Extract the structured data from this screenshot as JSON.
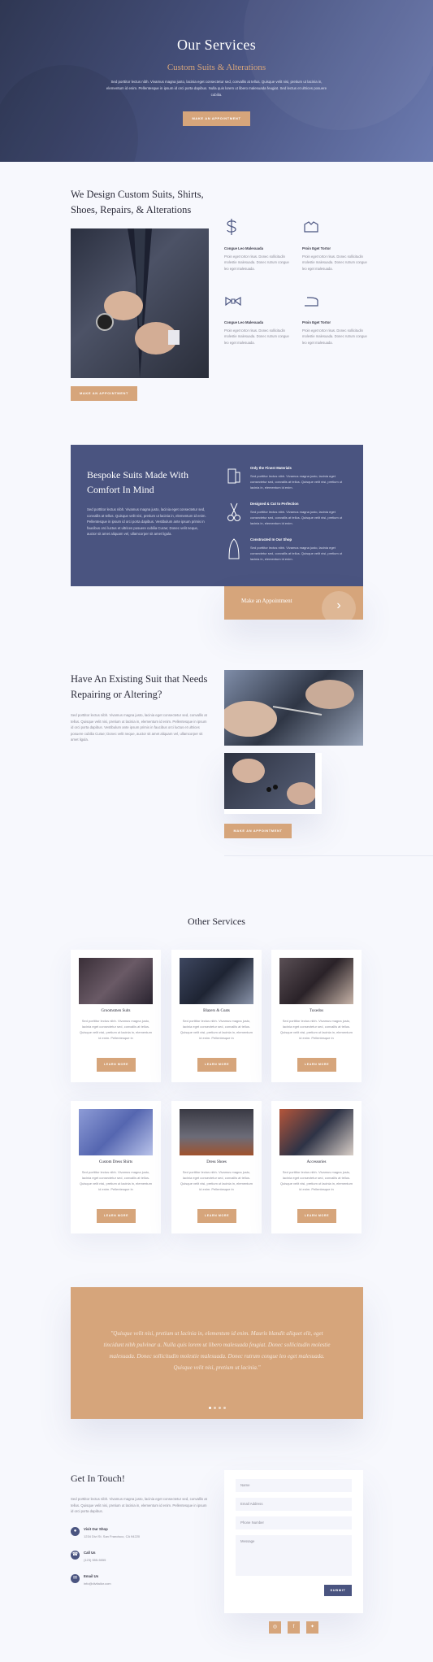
{
  "hero": {
    "title": "Our Services",
    "subtitle": "Custom Suits & Alterations",
    "body": "Sed porttitor lectus nibh. Vivamus magna justo, lacinia eget consectetur sed, convallis at tellus. Quisque velit nisi, pretium ut lacinia in, elementum id enim. Pellentesque in ipsum id orci porta dapibus. Nulla quis lorem ut libero malesuada feugiat. Sed lectus et ultrices posuere cubilia.",
    "button": "Make an Appointment"
  },
  "design": {
    "title": "We Design Custom Suits, Shirts, Shoes, Repairs, & Alterations",
    "button": "Make an Appointment",
    "features": [
      {
        "icon": "dollar-needle-icon",
        "title": "Congue Leo Malesuada",
        "text": "Proin eget tortor risus. Donec sollicitudin molestie malesuada. Donec rutrum congue leo eget malesuada."
      },
      {
        "icon": "shirt-icon",
        "title": "Proin Eget Tortor",
        "text": "Proin eget tortor risus. Donec sollicitudin molestie malesuada. Donec rutrum congue leo eget malesuada."
      },
      {
        "icon": "bowtie-icon",
        "title": "Congue Leo Malesuada",
        "text": "Proin eget tortor risus. Donec sollicitudin molestie malesuada. Donec rutrum congue leo eget malesuada."
      },
      {
        "icon": "iron-icon",
        "title": "Proin Eget Tortor",
        "text": "Proin eget tortor risus. Donec sollicitudin molestie malesuada. Donec rutrum congue leo eget malesuada."
      }
    ]
  },
  "bespoke": {
    "title": "Bespoke Suits Made With Comfort In Mind",
    "body": "Sed porttitor lectus nibh. Vivamus magna justo, lacinia eget consectetur sed, convallis at tellus. Quisque velit nisi, pretium ut lacinia in, elementum id enim. Pellentesque in ipsum id orci porta dapibus. Vestibulum ante ipsum primis in faucibus orci luctus et ultrices posuere cubilia Curae; Donec velit neque, auctor sit amet aliquam vel, ullamcorper sit amet ligula.",
    "items": [
      {
        "icon": "fabric-icon",
        "title": "Only the Finest Materials",
        "text": "Sed porttitor lectus nibh. Vivamus magna justo, lacinia eget consectetur sed, convallis at tellus. Quisque velit nisi, pretium ut lacinia in, elementum id enim."
      },
      {
        "icon": "scissors-icon",
        "title": "Designed & Cut to Perfection",
        "text": "Sed porttitor lectus nibh. Vivamus magna justo, lacinia eget consectetur sed, convallis at tellus. Quisque velit nisi, pretium ut lacinia in, elementum id enim."
      },
      {
        "icon": "tailor-icon",
        "title": "Constructed In Our Shop",
        "text": "Sed porttitor lectus nibh. Vivamus magna justo, lacinia eget consectetur sed, convallis at tellus. Quisque velit nisi, pretium ut lacinia in, elementum id enim."
      }
    ],
    "cta": "Make an Appointment"
  },
  "repair": {
    "title": "Have An Existing Suit that Needs Repairing or Altering?",
    "body": "Sed porttitor lectus nibh. Vivamus magna justo, lacinia eget consectetur sed, convallis at tellus. Quisque velit nisi, pretium ut lacinia in, elementum id enim. Pellentesque in ipsum id orci porta dapibus. Vestibulum ante ipsum primis in faucibus orci luctus et ultrices posuere cubilia Curae; Donec velit neque, auctor sit amet aliquam vel, ullamcorper sit amet ligula.",
    "button": "Make an Appointment"
  },
  "services": {
    "title": "Other Services",
    "card_text": "Sed porttitor lectus nibh. Vivamus magna justo, lacinia eget consectetur sed, convallis at tellus. Quisque velit nisi, pretium ut lacinia in, elementum id enim. Pellentesque in",
    "button": "Learn More",
    "cards": [
      {
        "title": "Groomsmen Suits"
      },
      {
        "title": "Blazers & Coats"
      },
      {
        "title": "Tuxedos"
      },
      {
        "title": "Custom Dress Shirts"
      },
      {
        "title": "Dress Shoes"
      },
      {
        "title": "Accessories"
      }
    ]
  },
  "testimonial": {
    "quote": "\"Quisque velit nisi, pretium ut lacinia in, elementum id enim. Mauris blandit aliquet elit, eget tincidunt nibh pulvinar a. Nulla quis lorem ut libero malesuada feugiat. Donec sollicitudin molestie malesuada. Donec sollicitudin molestie malesuada. Donec rutrum congue leo eget malesuada. Quisque velit nisi, pretium ut lacinia.\""
  },
  "contact": {
    "title": "Get In Touch!",
    "body": "Sed porttitor lectus nibh. Vivamus magna justo, lacinia eget consectetur sed, convallis at tellus. Quisque velit nisi, pretium ut lacinia in, elementum id enim. Pellentesque in ipsum id orci porta dapibus.",
    "visit_label": "Visit Our Shop",
    "visit_value": "1234 Divi St. San Francisco, CA 94220",
    "call_label": "Call Us",
    "call_value": "(123) 555-5555",
    "email_label": "Email Us",
    "email_value": "info@divitailor.com",
    "name_placeholder": "Name",
    "email_placeholder": "Email Address",
    "phone_placeholder": "Phone Number",
    "message_placeholder": "Message",
    "submit": "Submit"
  },
  "colors": {
    "accent": "#d6a57b",
    "navy": "#4a5480",
    "background": "#f7f8fd"
  }
}
